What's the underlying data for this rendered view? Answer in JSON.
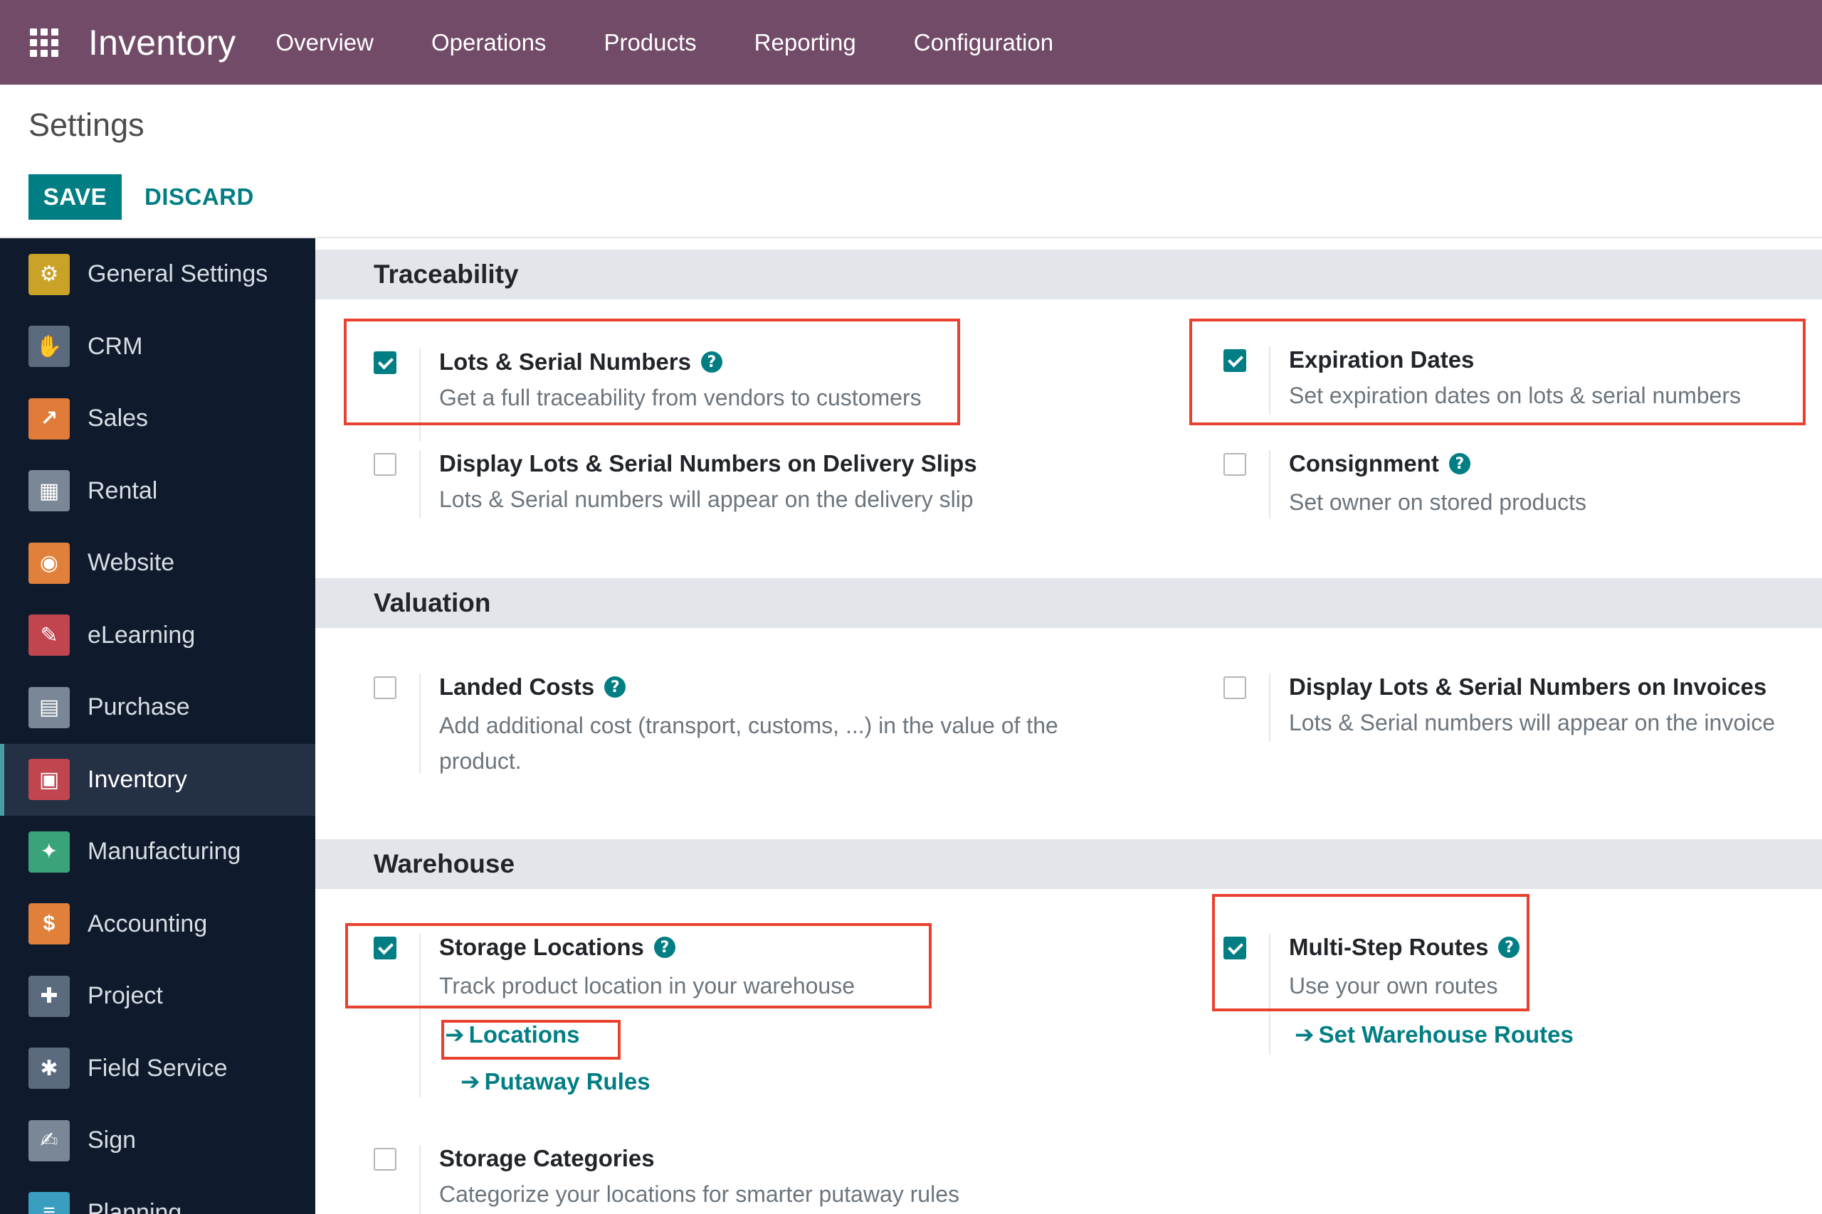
{
  "navbar": {
    "apps_icon": "grid-icon",
    "brand": "Inventory",
    "menu": [
      "Overview",
      "Operations",
      "Products",
      "Reporting",
      "Configuration"
    ]
  },
  "control_panel": {
    "title": "Settings",
    "save_label": "SAVE",
    "discard_label": "DISCARD"
  },
  "sidebar": {
    "items": [
      {
        "label": "General Settings",
        "icon": "gear-icon",
        "color": "#c9a227",
        "glyph": "⚙"
      },
      {
        "label": "CRM",
        "icon": "handshake-icon",
        "color": "#5b6b7d",
        "glyph": "✋"
      },
      {
        "label": "Sales",
        "icon": "chart-icon",
        "color": "#e07b39",
        "glyph": "↗"
      },
      {
        "label": "Rental",
        "icon": "rental-icon",
        "color": "#7a8796",
        "glyph": "▦"
      },
      {
        "label": "Website",
        "icon": "globe-icon",
        "color": "#e0803a",
        "glyph": "◉"
      },
      {
        "label": "eLearning",
        "icon": "elearning-icon",
        "color": "#c0454f",
        "glyph": "✎"
      },
      {
        "label": "Purchase",
        "icon": "purchase-icon",
        "color": "#7a8796",
        "glyph": "▤"
      },
      {
        "label": "Inventory",
        "icon": "box-icon",
        "color": "#c0454f",
        "glyph": "▣"
      },
      {
        "label": "Manufacturing",
        "icon": "wrench-icon",
        "color": "#3aa37a",
        "glyph": "✦"
      },
      {
        "label": "Accounting",
        "icon": "accounting-icon",
        "color": "#e0803a",
        "glyph": "$"
      },
      {
        "label": "Project",
        "icon": "puzzle-icon",
        "color": "#5b6b7d",
        "glyph": "✚"
      },
      {
        "label": "Field Service",
        "icon": "field-service-icon",
        "color": "#5b6b7d",
        "glyph": "✱"
      },
      {
        "label": "Sign",
        "icon": "sign-icon",
        "color": "#7a8796",
        "glyph": "✍"
      },
      {
        "label": "Planning",
        "icon": "planning-icon",
        "color": "#3a9ec0",
        "glyph": "≡"
      }
    ],
    "active": "Inventory"
  },
  "sections": {
    "traceability": {
      "title": "Traceability",
      "lots_serial": {
        "title": "Lots & Serial Numbers",
        "desc": "Get a full traceability from vendors to customers",
        "checked": true
      },
      "expiration": {
        "title": "Expiration Dates",
        "desc": "Set expiration dates on lots & serial numbers",
        "checked": true
      },
      "display_lots_delivery": {
        "title": "Display Lots & Serial Numbers on Delivery Slips",
        "desc": "Lots & Serial numbers will appear on the delivery slip",
        "checked": false
      },
      "consignment": {
        "title": "Consignment",
        "desc": "Set owner on stored products",
        "checked": false
      }
    },
    "valuation": {
      "title": "Valuation",
      "landed_costs": {
        "title": "Landed Costs",
        "desc_line1": "Add additional cost (transport, customs, ...) in the value of the",
        "desc_line2": "product.",
        "checked": false
      },
      "display_lots_invoices": {
        "title": "Display Lots & Serial Numbers on Invoices",
        "desc": "Lots & Serial numbers will appear on the invoice",
        "checked": false
      }
    },
    "warehouse": {
      "title": "Warehouse",
      "storage_locations": {
        "title": "Storage Locations",
        "desc": "Track product location in your warehouse",
        "checked": true,
        "link_locations": "Locations",
        "link_putaway": "Putaway Rules"
      },
      "multi_step": {
        "title": "Multi-Step Routes",
        "desc": "Use your own routes",
        "checked": true,
        "link_routes": "Set Warehouse Routes"
      },
      "storage_categories": {
        "title": "Storage Categories",
        "desc": "Categorize your locations for smarter putaway rules",
        "checked": false
      }
    }
  },
  "help_glyph": "?",
  "arrow_glyph": "➔",
  "colors": {
    "navbar": "#714b67",
    "primary": "#017e84",
    "sidebar": "#0f1b2d",
    "highlight": "#e8412f"
  }
}
